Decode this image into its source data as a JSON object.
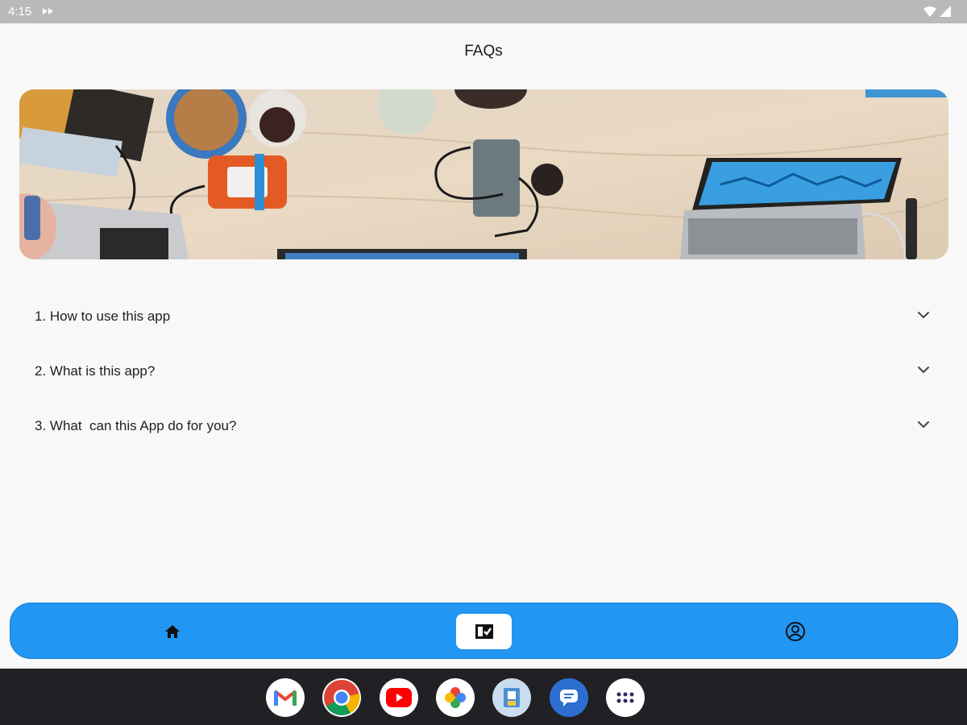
{
  "status_bar": {
    "time": "4:15",
    "icons": [
      "media-icon",
      "wifi-icon",
      "signal-icon"
    ]
  },
  "page": {
    "title": "FAQs",
    "hero_image": "desk-workspace-photo"
  },
  "faqs": [
    {
      "question": "1. How to use this app",
      "icon": "chevron-down-icon"
    },
    {
      "question": "2. What is this app?",
      "icon": "chevron-down-icon"
    },
    {
      "question": "3. What  can this App do for you?",
      "icon": "chevron-down-icon"
    }
  ],
  "bottom_nav": {
    "items": [
      {
        "name": "home",
        "icon": "home-icon"
      },
      {
        "name": "faq",
        "icon": "faq-icon",
        "selected": true
      },
      {
        "name": "profile",
        "icon": "profile-icon"
      }
    ],
    "background": "#2196f3"
  },
  "taskbar": {
    "apps": [
      "gmail-icon",
      "chrome-icon",
      "youtube-icon",
      "photos-icon",
      "files-icon",
      "messages-icon",
      "app-launcher-icon"
    ]
  }
}
